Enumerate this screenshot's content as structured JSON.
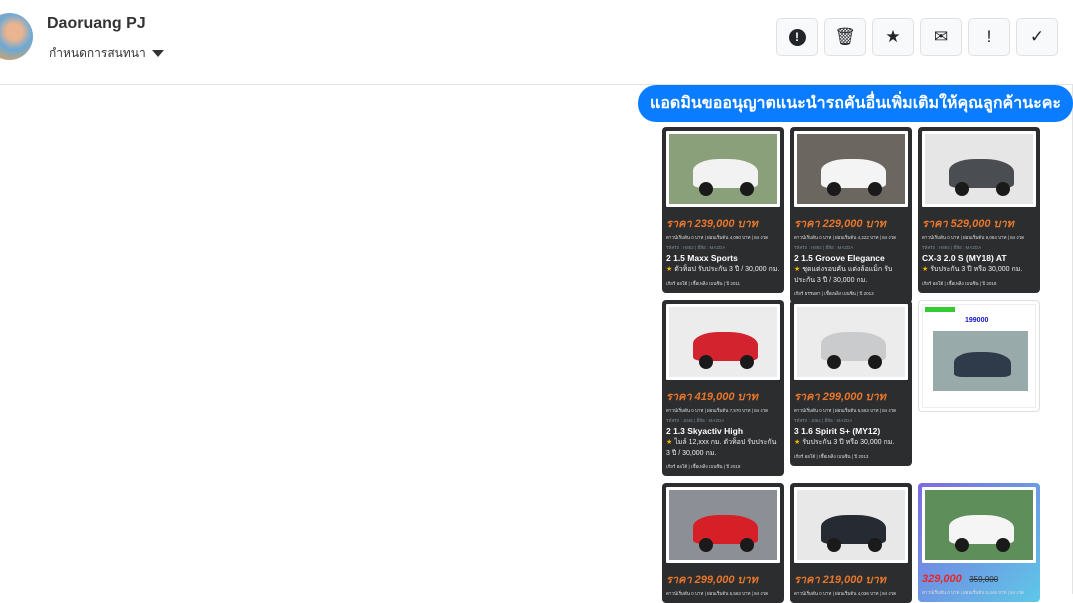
{
  "header": {
    "name": "Daoruang PJ",
    "conversation_label": "กำหนดการสนทนา"
  },
  "toolbar": [
    {
      "name": "report-button",
      "icon": "exclamation-circle-icon",
      "glyph": "⬤"
    },
    {
      "name": "delete-button",
      "icon": "trash-icon",
      "glyph": "🗑"
    },
    {
      "name": "star-button",
      "icon": "star-icon",
      "glyph": "★"
    },
    {
      "name": "mail-button",
      "icon": "envelope-icon",
      "glyph": "✉"
    },
    {
      "name": "important-button",
      "icon": "exclamation-icon",
      "glyph": "!"
    },
    {
      "name": "done-button",
      "icon": "check-icon",
      "glyph": "✓"
    }
  ],
  "message": {
    "text": "แอดมินขออนุญาตแนะนำรถคันอื่นเพิ่มเติมให้คุณลูกค้านะคะ"
  },
  "cards": [
    {
      "price": "ราคา 239,000 บาท",
      "sub": "ดาวน์เริ่มต้น 0 บาท | ผ่อนเริ่มต้น 4,090 บาท | 84 งวด",
      "tag": "รหัสรถ : H862 | ยี่ห้อ : MAZDA",
      "model": "2 1.5 Maxx Sports",
      "feature": "ตัวท็อป รับประกัน 3 ปี / 30,000 กม.",
      "foot": "เกียร์ ออโต้ | เชื้อเพลิง เบนซิน | ปี 2011",
      "color": "#f2f2f2",
      "bg": "#8aa07a"
    },
    {
      "price": "ราคา 229,000 บาท",
      "sub": "ดาวน์เริ่มต้น 0 บาท | ผ่อนเริ่มต้น 4,222 บาท | 84 งวด",
      "tag": "รหัสรถ : H892 | ยี่ห้อ : MAZDA",
      "model": "2 1.5 Groove Elegance",
      "feature": "ชุดแต่งรอบคัน แต่งล้อแม็ก รับประกัน 3 ปี / 30,000 กม.",
      "foot": "เกียร์ ธรรมดา | เชื้อเพลิง เบนซิน | ปี 2013",
      "color": "#f4f4f4",
      "bg": "#6b6660"
    },
    {
      "price": "ราคา 529,000 บาท",
      "sub": "ดาวน์เริ่มต้น 0 บาท | ผ่อนเริ่มต้น 9,084 บาท | 84 งวด",
      "tag": "รหัสรถ : H894 | ยี่ห้อ : MAZDA",
      "model": "CX-3 2.0 S (MY18) AT",
      "feature": "รับประกัน 3 ปี หรือ 30,000 กม.",
      "foot": "เกียร์ ออโต้ | เชื้อเพลิง เบนซิน | ปี 2018",
      "color": "#4a4d52",
      "bg": "#e6e6e6"
    },
    {
      "price": "ราคา 419,000 บาท",
      "sub": "ดาวน์เริ่มต้น 0 บาท | ผ่อนเริ่มต้น 7,570 บาท | 84 งวด",
      "tag": "รหัสรถ : J845 | ยี่ห้อ : MAZDA",
      "model": "2 1.3 Skyactiv High",
      "feature": "ไมล์ 12,xxx กม. ตัวท็อป รับประกัน 3 ปี / 30,000 กม.",
      "foot": "เกียร์ ออโต้ | เชื้อเพลิง เบนซิน | ปี 2019",
      "color": "#d2232f",
      "bg": "#ececec"
    },
    {
      "price": "ราคา 299,000 บาท",
      "sub": "ดาวน์เริ่มต้น 0 บาท | ผ่อนเริ่มต้น 5,563 บาท | 84 งวด",
      "tag": "รหัสรถ : J862 | ยี่ห้อ : MAZDA",
      "model": "3 1.6 Spirit S+ (MY12)",
      "feature": "รับประกัน 3 ปี หรือ 30,000 กม.",
      "foot": "เกียร์ ออโต้ | เชื้อเพลิง เบนซิน | ปี 2013",
      "color": "#c9cbcd",
      "bg": "#ececec"
    },
    {
      "ad": true,
      "price": "199000",
      "color": "#2f3a4a",
      "bg": "#ffffff"
    },
    {
      "price": "ราคา 299,000 บาท",
      "sub": "ดาวน์เริ่มต้น 0 บาท | ผ่อนเริ่มต้น 5,563 บาท | 84 งวด",
      "color": "#d61f26",
      "bg": "#8c9096"
    },
    {
      "price": "ราคา 219,000 บาท",
      "sub": "ดาวน์เริ่มต้น 0 บาท | ผ่อนเริ่มต้น 4,036 บาท | 84 งวด",
      "color": "#262a33",
      "bg": "#e8e8e8"
    },
    {
      "grad": true,
      "price": "329,000",
      "old_price": "359,000",
      "sub": "ดาวน์เริ่มต้น 0 บาท | ผ่อนเริ่มต้น 5,649 บาท | 84 งวด",
      "color": "#f5f5f5",
      "bg": "#5e8f5a"
    }
  ]
}
